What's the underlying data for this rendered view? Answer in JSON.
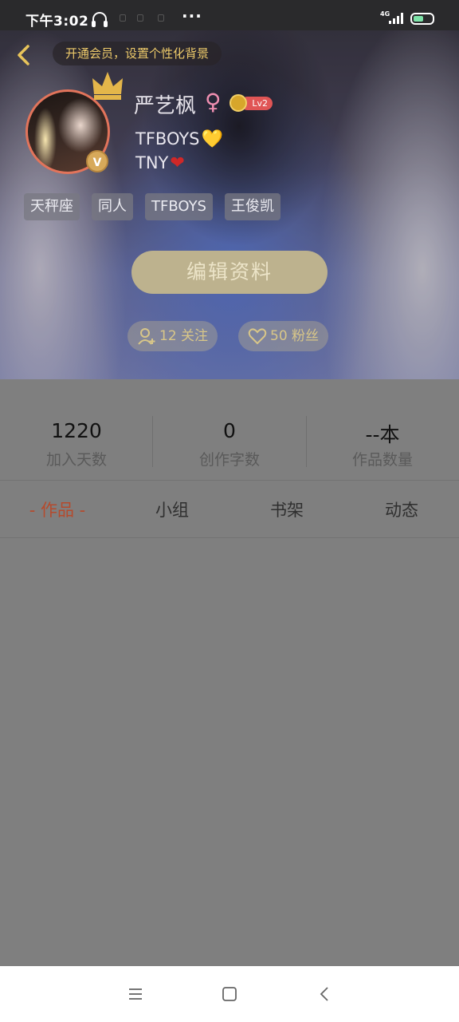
{
  "status_bar": {
    "time": "下午3:02",
    "network": "4G",
    "more_label": "···"
  },
  "header": {
    "vip_tip": "开通会员，设置个性化背景",
    "user_name": "严艺枫",
    "gender_symbol": "♀",
    "level": "Lv2",
    "avatar_badge": "V",
    "bio_lines": [
      "TFBOYS",
      "TNY"
    ],
    "bio_hearts": [
      "💛",
      "❤"
    ],
    "tags": [
      "天秤座",
      "同人",
      "TFBOYS",
      "王俊凯"
    ],
    "edit_button": "编辑资料",
    "following": "12 关注",
    "followers": "50 粉丝"
  },
  "stats": [
    {
      "value": "1220",
      "label": "加入天数"
    },
    {
      "value": "0",
      "label": "创作字数"
    },
    {
      "value": "--本",
      "label": "作品数量"
    }
  ],
  "tabs": [
    {
      "label": "- 作品 -",
      "active": true
    },
    {
      "label": "小组",
      "active": false
    },
    {
      "label": "书架",
      "active": false
    },
    {
      "label": "动态",
      "active": false
    }
  ],
  "colors": {
    "accent_gold": "#ecc96a",
    "active_tab": "#b54a2c",
    "overlay": "#7f7f7f"
  },
  "icons": [
    "headset-icon",
    "back-icon",
    "crown-icon",
    "user-add-icon",
    "heart-icon",
    "menu-icon",
    "home-icon",
    "nav-back-icon"
  ]
}
